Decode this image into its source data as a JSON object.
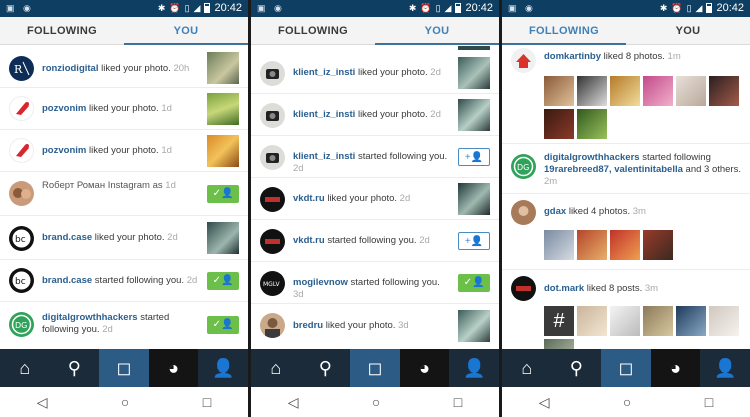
{
  "status": {
    "time": "20:42"
  },
  "tabs": {
    "following": "FOLLOWING",
    "you": "YOU"
  },
  "screen1": {
    "items": [
      {
        "user": "ronziodigital",
        "text": " liked your photo.",
        "time": " 20h"
      },
      {
        "user": "pozvonim",
        "text": " liked your photo.",
        "time": " 1d"
      },
      {
        "user": "pozvonim",
        "text": " liked your photo.",
        "time": " 1d"
      },
      {
        "user": "",
        "text": "Roберт Роман Instagram as",
        "time": " 1d"
      },
      {
        "user": "brand.case",
        "text": " liked your photo.",
        "time": " 2d"
      },
      {
        "user": "brand.case",
        "text": " started following you.",
        "time": " 2d"
      },
      {
        "user": "digitalgrowthhackers",
        "text": " started following you.",
        "time": " 2d"
      }
    ]
  },
  "screen2": {
    "items": [
      {
        "user": "klient_iz_insti",
        "text": " liked your photo.",
        "time": " 2d"
      },
      {
        "user": "klient_iz_insti",
        "text": " liked your photo.",
        "time": " 2d"
      },
      {
        "user": "klient_iz_insti",
        "text": " started following you.",
        "time": " 2d"
      },
      {
        "user": "vkdt.ru",
        "text": " liked your photo.",
        "time": " 2d"
      },
      {
        "user": "vkdt.ru",
        "text": " started following you.",
        "time": " 2d"
      },
      {
        "user": "mogilevnow",
        "text": " started following you.",
        "time": " 3d"
      },
      {
        "user": "bredru",
        "text": " liked your photo.",
        "time": " 3d"
      }
    ]
  },
  "screen3": {
    "items": [
      {
        "user": "domkartinby",
        "text": " liked 8 photos.",
        "time": " 1m"
      },
      {
        "user": "digitalgrowthhackers",
        "text": " started following ",
        "mentions": "19rarebreed87, valentinitabella",
        "suffix": " and 3 others.",
        "time": "2m"
      },
      {
        "user": "gdax",
        "text": " liked 4 photos.",
        "time": " 3m"
      },
      {
        "user": "dot.mark",
        "text": " liked 8 posts.",
        "time": " 3m"
      }
    ]
  },
  "nav": {
    "icons": [
      "home-icon",
      "search-icon",
      "camera-icon",
      "activity-icon",
      "profile-icon"
    ]
  },
  "colors": {
    "statusbar": "#0e3e62",
    "accent": "#3f729b",
    "follow_green": "#6cc04a",
    "nav_bg": "#1c2b3a",
    "nav_active": "#2c5b86"
  }
}
